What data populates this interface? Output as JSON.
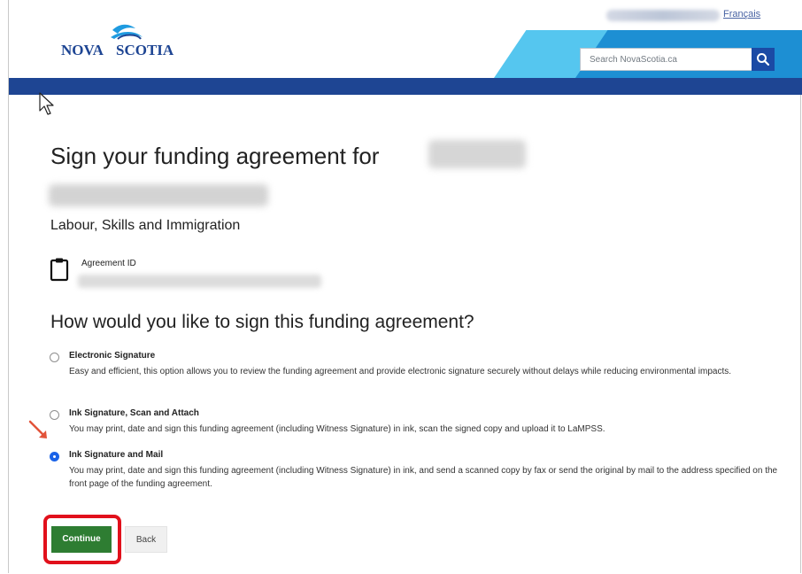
{
  "header": {
    "language_link": "Français",
    "logo_text_left": "NOVA",
    "logo_text_right": "SCOTIA",
    "search_placeholder": "Search NovaScotia.ca"
  },
  "page": {
    "title": "Sign your funding agreement for",
    "department": "Labour, Skills and Immigration",
    "agreement_id_label": "Agreement ID",
    "question": "How would you like to sign this funding agreement?"
  },
  "options": [
    {
      "title": "Electronic Signature",
      "description": "Easy and efficient, this option allows you to review the funding agreement and provide electronic signature securely without delays while reducing environmental impacts.",
      "checked": false
    },
    {
      "title": "Ink Signature, Scan and Attach",
      "description": "You may print, date and sign this funding agreement (including Witness Signature) in ink, scan the signed copy and upload it to LaMPSS.",
      "checked": false
    },
    {
      "title": "Ink Signature and Mail",
      "description": "You may print, date and sign this funding agreement (including Witness Signature) in ink, and send a scanned copy by fax or send the original by mail to the address specified on the front page of the funding agreement.",
      "checked": true
    }
  ],
  "actions": {
    "continue_label": "Continue",
    "back_label": "Back"
  },
  "colors": {
    "nav_blue": "#1e4593",
    "accent_light": "#55c6ef",
    "continue_green": "#2e7d32",
    "highlight_red": "#e1101b"
  },
  "icons": [
    "search-icon",
    "clipboard-icon",
    "pointer-cursor-icon",
    "red-arrow-icon"
  ]
}
